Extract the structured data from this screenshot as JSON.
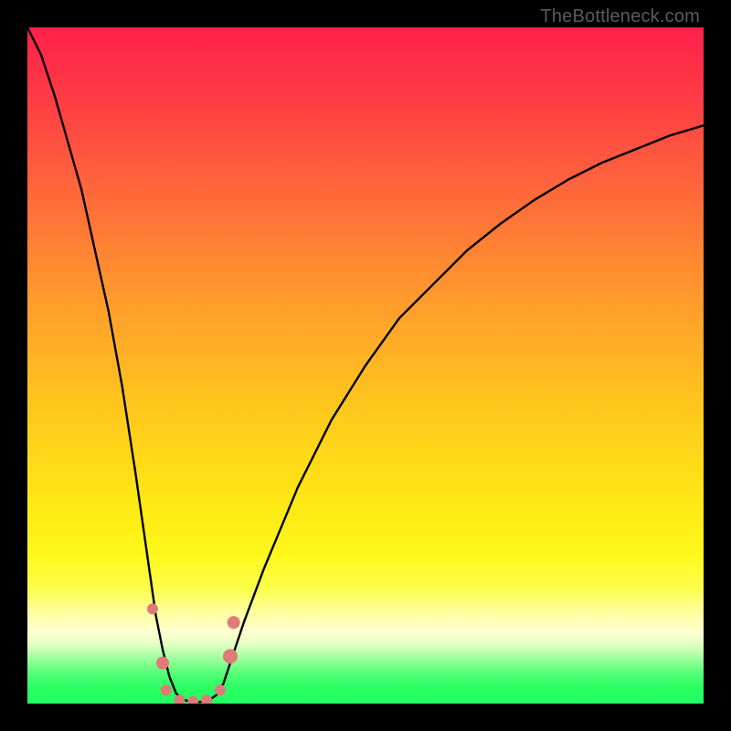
{
  "watermark": "TheBottleneck.com",
  "colors": {
    "frame_bg": "#000000",
    "curve_stroke": "#000000",
    "marker_fill": "#e07a78",
    "green_band": "#21fd61"
  },
  "gradient_stops": [
    {
      "offset": 0.0,
      "color": "#ff1f4a"
    },
    {
      "offset": 0.1,
      "color": "#ff3a45"
    },
    {
      "offset": 0.25,
      "color": "#ff6a3a"
    },
    {
      "offset": 0.4,
      "color": "#ff9a2c"
    },
    {
      "offset": 0.55,
      "color": "#ffc41e"
    },
    {
      "offset": 0.7,
      "color": "#ffe714"
    },
    {
      "offset": 0.78,
      "color": "#fff81a"
    },
    {
      "offset": 0.83,
      "color": "#fbff4a"
    },
    {
      "offset": 0.865,
      "color": "#ffffa0"
    },
    {
      "offset": 0.895,
      "color": "#ffffd0"
    },
    {
      "offset": 0.915,
      "color": "#dcffc0"
    },
    {
      "offset": 0.935,
      "color": "#97ff9a"
    },
    {
      "offset": 0.955,
      "color": "#56ff78"
    },
    {
      "offset": 0.975,
      "color": "#2bff63"
    },
    {
      "offset": 1.0,
      "color": "#21fd61"
    }
  ],
  "chart_data": {
    "type": "line",
    "title": "",
    "xlabel": "",
    "ylabel": "",
    "xlim": [
      0,
      100
    ],
    "ylim": [
      0,
      100
    ],
    "series": [
      {
        "name": "bottleneck-curve",
        "x": [
          0,
          2,
          4,
          6,
          8,
          10,
          12,
          14,
          16,
          18,
          19,
          20,
          21,
          22,
          23,
          24,
          25,
          26,
          27,
          28,
          29,
          30,
          32,
          35,
          40,
          45,
          50,
          55,
          60,
          65,
          70,
          75,
          80,
          85,
          90,
          95,
          100
        ],
        "y": [
          100,
          96,
          90,
          83,
          76,
          67,
          58,
          47,
          34,
          20,
          13,
          8,
          4,
          1.5,
          0.6,
          0.3,
          0.2,
          0.3,
          0.6,
          1.3,
          3,
          6,
          12,
          20,
          32,
          42,
          50,
          57,
          62,
          67,
          71,
          74.5,
          77.5,
          80,
          82,
          84,
          85.5
        ]
      }
    ],
    "markers": [
      {
        "x": 18.5,
        "y": 14,
        "r": 6
      },
      {
        "x": 20.0,
        "y": 6,
        "r": 7
      },
      {
        "x": 20.5,
        "y": 2,
        "r": 6
      },
      {
        "x": 22.5,
        "y": 0.5,
        "r": 6
      },
      {
        "x": 24.5,
        "y": 0.3,
        "r": 6
      },
      {
        "x": 26.5,
        "y": 0.5,
        "r": 6
      },
      {
        "x": 28.5,
        "y": 2,
        "r": 6
      },
      {
        "x": 30.0,
        "y": 7,
        "r": 8
      },
      {
        "x": 30.5,
        "y": 12,
        "r": 7
      }
    ],
    "legend": [],
    "grid": false
  }
}
